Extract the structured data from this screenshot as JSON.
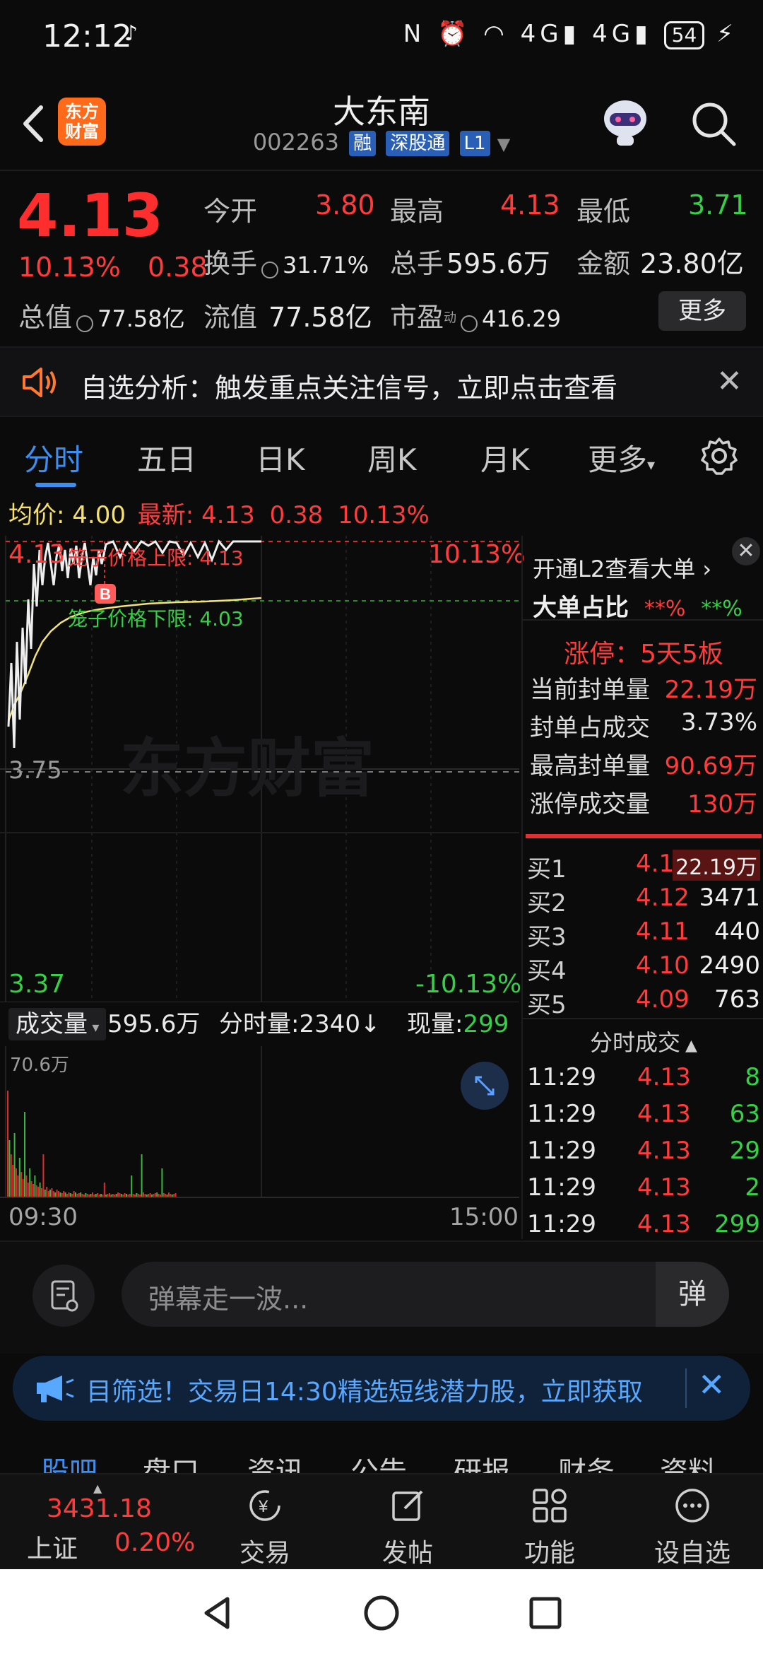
{
  "status": {
    "time": "12:12",
    "battery": "54"
  },
  "header": {
    "title": "大东南",
    "code": "002263",
    "tags": [
      "融",
      "深股通",
      "L1"
    ],
    "logo_text_1": "东方",
    "logo_text_2": "财富"
  },
  "quote": {
    "price": "4.13",
    "change_pct": "10.13%",
    "change": "0.38",
    "open_label": "今开",
    "open": "3.80",
    "high_label": "最高",
    "high": "4.13",
    "low_label": "最低",
    "low": "3.71",
    "turnover_label": "换手",
    "turnover": "31.71%",
    "volume_label": "总手",
    "volume": "595.6万",
    "amount_label": "金额",
    "amount": "23.80亿",
    "mktcap_label": "总值",
    "mktcap": "77.58亿",
    "float_label": "流值",
    "float": "77.58亿",
    "pe_label": "市盈",
    "pe_sup": "动",
    "pe": "416.29",
    "more": "更多"
  },
  "alert": {
    "text": "自选分析：触发重点关注信号，立即点击查看"
  },
  "tabs": [
    "分时",
    "五日",
    "日K",
    "周K",
    "月K",
    "更多"
  ],
  "chart_header": {
    "avg_label": "均价:",
    "avg": "4.00",
    "latest_label": "最新:",
    "latest": "4.13",
    "latest_chg": "0.38",
    "latest_pct": "10.13%"
  },
  "chart": {
    "top_price": "4.13",
    "top_pct": "10.13%",
    "upper_limit_label": "笼子价格上限:",
    "upper_limit": "4.13",
    "lower_limit_label": "笼子价格下限:",
    "lower_limit": "4.03",
    "mid_price": "3.75",
    "bottom_price": "3.37",
    "bottom_pct": "-10.13%",
    "watermark": "东方财富",
    "b_marker": "B"
  },
  "vol_header": {
    "select": "成交量",
    "total": "595.6万",
    "tick_label": "分时量:2340↓",
    "now_label": "现量:",
    "now": "299"
  },
  "vol": {
    "max": "70.6万",
    "start_time": "09:30",
    "end_time": "15:00"
  },
  "rpanel": {
    "l2_link": "开通L2查看大单",
    "big_ratio_label": "大单占比",
    "big_ratio_red": "**%",
    "big_ratio_green": "**%",
    "limit_up": "涨停：5天5板",
    "stats": [
      {
        "label": "当前封单量",
        "value": "22.19万"
      },
      {
        "label": "封单占成交",
        "value": "3.73%"
      },
      {
        "label": "最高封单量",
        "value": "90.69万"
      },
      {
        "label": "涨停成交量",
        "value": "130万"
      }
    ],
    "bids": [
      {
        "label": "买1",
        "price": "4.13",
        "qty": "22.19万"
      },
      {
        "label": "买2",
        "price": "4.12",
        "qty": "3471"
      },
      {
        "label": "买3",
        "price": "4.11",
        "qty": "440"
      },
      {
        "label": "买4",
        "price": "4.10",
        "qty": "2490"
      },
      {
        "label": "买5",
        "price": "4.09",
        "qty": "763"
      }
    ],
    "ticks_title": "分时成交",
    "ticks": [
      {
        "time": "11:29",
        "price": "4.13",
        "qty": "8"
      },
      {
        "time": "11:29",
        "price": "4.13",
        "qty": "63"
      },
      {
        "time": "11:29",
        "price": "4.13",
        "qty": "29"
      },
      {
        "time": "11:29",
        "price": "4.13",
        "qty": "2"
      },
      {
        "time": "11:29",
        "price": "4.13",
        "qty": "299"
      }
    ]
  },
  "danmu": {
    "placeholder": "弹幕走一波...",
    "send": "弹"
  },
  "promo": {
    "text": "目筛选！交易日14:30精选短线潜力股，立即获取"
  },
  "subtabs": [
    "股吧",
    "盘口",
    "资讯",
    "公告",
    "研报",
    "财务",
    "资料"
  ],
  "bottomnav": {
    "index_value": "3431.18",
    "index_name": "上证",
    "index_pct": "0.20%",
    "items": [
      "交易",
      "发帖",
      "功能",
      "设自选"
    ]
  }
}
